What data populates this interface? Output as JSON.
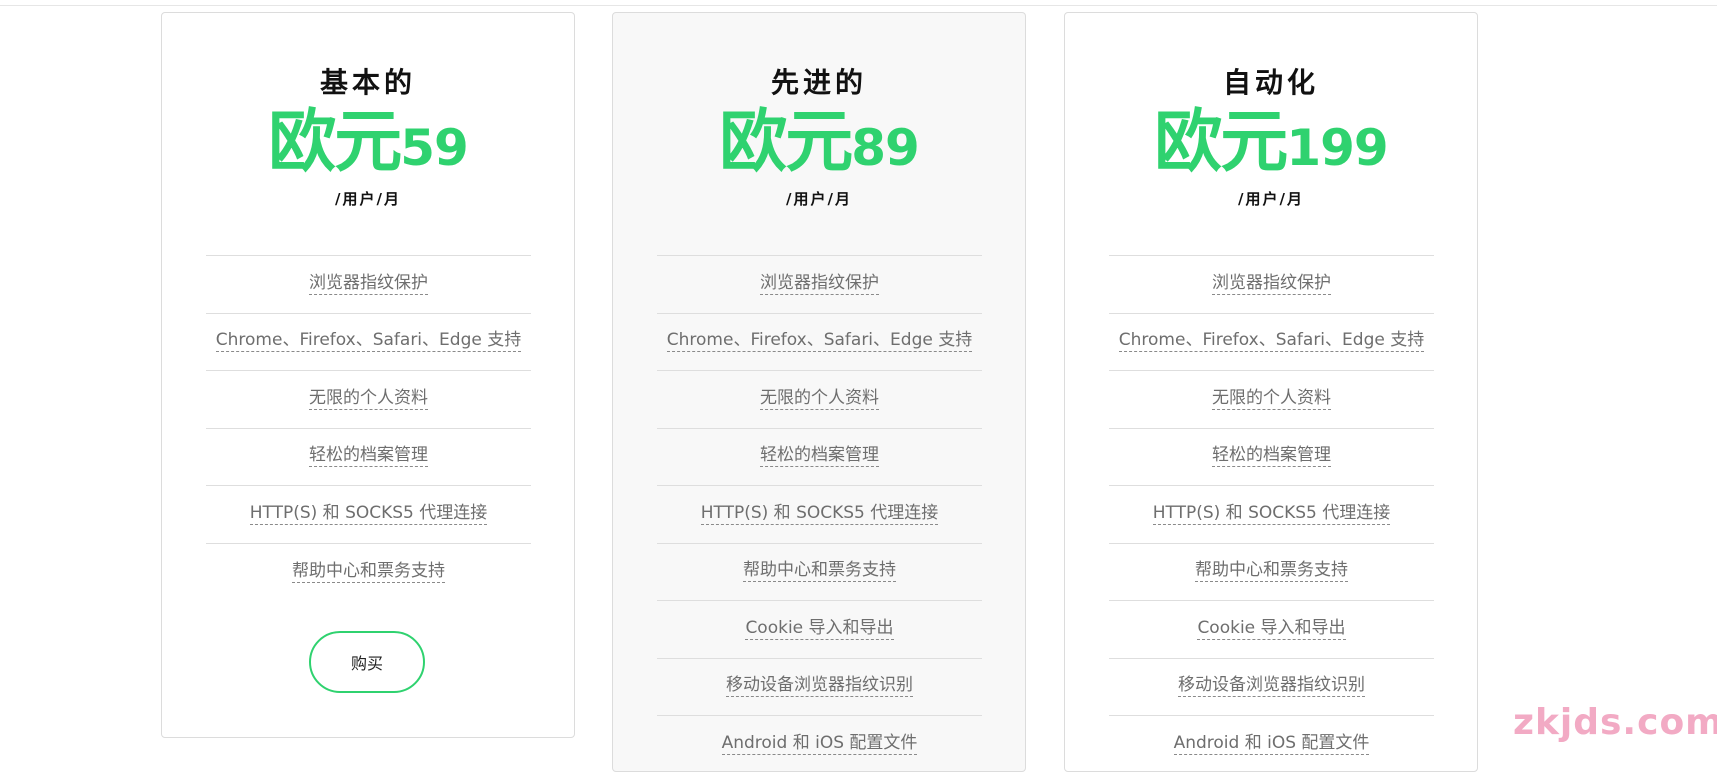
{
  "plans": [
    {
      "title": "基本的",
      "currency": "欧元",
      "amount": "59",
      "unit": "/用户/月",
      "features": [
        "浏览器指纹保护",
        "Chrome、Firefox、Safari、Edge 支持",
        "无限的个人资料",
        "轻松的档案管理",
        "HTTP(S) 和 SOCKS5 代理连接",
        "帮助中心和票务支持"
      ],
      "buy_label": "购买"
    },
    {
      "title": "先进的",
      "currency": "欧元",
      "amount": "89",
      "unit": "/用户/月",
      "features": [
        "浏览器指纹保护",
        "Chrome、Firefox、Safari、Edge 支持",
        "无限的个人资料",
        "轻松的档案管理",
        "HTTP(S) 和 SOCKS5 代理连接",
        "帮助中心和票务支持",
        "Cookie 导入和导出",
        "移动设备浏览器指纹识别",
        "Android 和 iOS 配置文件"
      ]
    },
    {
      "title": "自动化",
      "currency": "欧元",
      "amount": "199",
      "unit": "/用户/月",
      "features": [
        "浏览器指纹保护",
        "Chrome、Firefox、Safari、Edge 支持",
        "无限的个人资料",
        "轻松的档案管理",
        "HTTP(S) 和 SOCKS5 代理连接",
        "帮助中心和票务支持",
        "Cookie 导入和导出",
        "移动设备浏览器指纹识别",
        "Android 和 iOS 配置文件"
      ]
    }
  ],
  "watermark": "zkjds.com",
  "colors": {
    "accent": "#2fd26f",
    "text": "#111111",
    "feature_text": "#6e6e6e",
    "highlight_card_bg": "#f8f8f8",
    "watermark": "#f2aac4"
  }
}
